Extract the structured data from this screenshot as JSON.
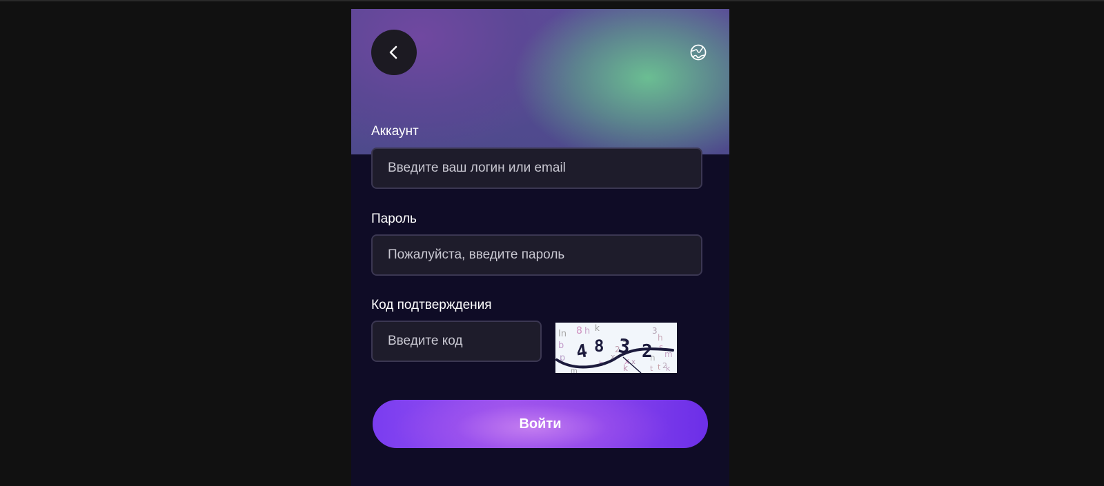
{
  "header": {
    "back_icon": "chevron-left-icon",
    "language_icon": "globe-icon"
  },
  "form": {
    "account": {
      "label": "Аккаунт",
      "placeholder": "Введите ваш логин или email",
      "value": ""
    },
    "password": {
      "label": "Пароль",
      "placeholder": "Пожалуйста, введите пароль",
      "value": ""
    },
    "captcha": {
      "label": "Код подтверждения",
      "placeholder": "Введите код",
      "value": "",
      "image_text": "4832"
    },
    "submit_label": "Войти"
  },
  "colors": {
    "page_bg": "#111111",
    "panel_bg": "#0f0c26",
    "field_bg": "#1e1c2b",
    "accent": "#8a45ec"
  }
}
